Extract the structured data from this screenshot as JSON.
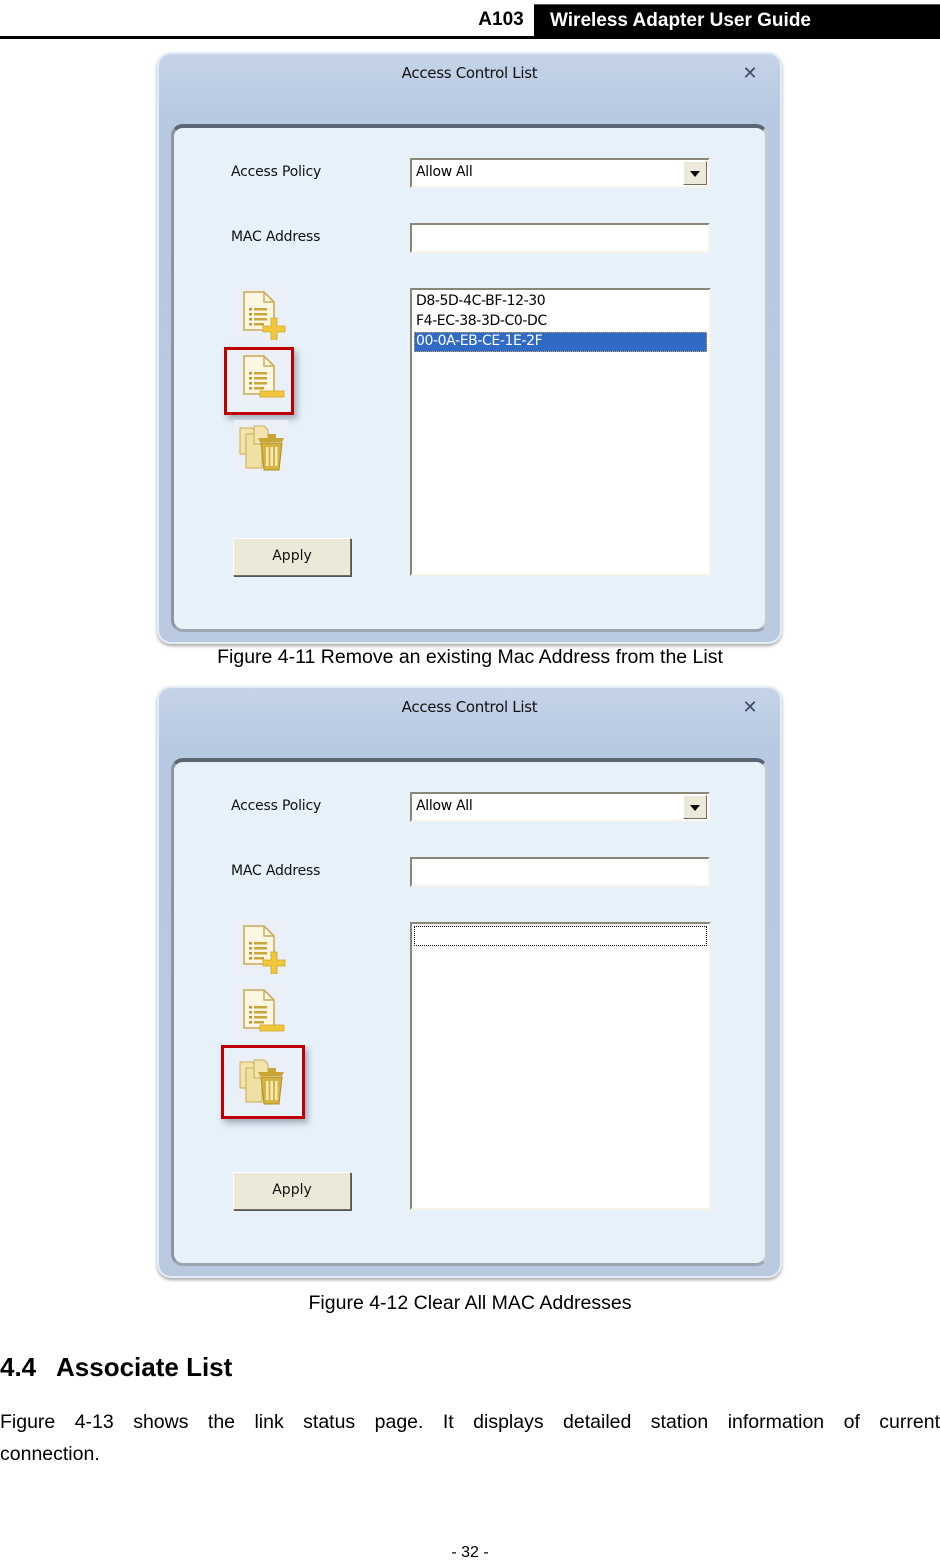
{
  "header": {
    "model": "A103",
    "title": "Wireless Adapter User Guide"
  },
  "figures": [
    {
      "dialog": {
        "title": "Access Control List",
        "close_icon": "close-icon",
        "access_policy_label": "Access Policy",
        "access_policy_value": "Allow All",
        "mac_address_label": "MAC Address",
        "mac_address_value": "",
        "mac_list": [
          "D8-5D-4C-BF-12-30",
          "F4-EC-38-3D-C0-DC",
          "00-0A-EB-CE-1E-2F"
        ],
        "selected_index": 2,
        "icons": [
          "add-entry-icon",
          "remove-entry-icon",
          "clear-all-icon"
        ],
        "highlighted_icon": "remove-entry-icon",
        "apply_label": "Apply"
      },
      "caption": "Figure 4-11 Remove an existing Mac Address from the List"
    },
    {
      "dialog": {
        "title": "Access Control List",
        "close_icon": "close-icon",
        "access_policy_label": "Access Policy",
        "access_policy_value": "Allow All",
        "mac_address_label": "MAC Address",
        "mac_address_value": "",
        "mac_list": [],
        "icons": [
          "add-entry-icon",
          "remove-entry-icon",
          "clear-all-icon"
        ],
        "highlighted_icon": "clear-all-icon",
        "apply_label": "Apply"
      },
      "caption": "Figure 4-12 Clear All MAC Addresses"
    }
  ],
  "section": {
    "number": "4.4",
    "title": "Associate List",
    "paragraph": "Figure 4-13 shows the link status page. It displays detailed station information of current connection."
  },
  "footer": {
    "page_number": "- 32 -"
  },
  "colors": {
    "selection": "#316ac5",
    "highlight_box": "#c00000",
    "icon_gold": "#d9b84a",
    "dialog_frame": "#b8c9e0",
    "dialog_body": "#e6f1f9"
  }
}
